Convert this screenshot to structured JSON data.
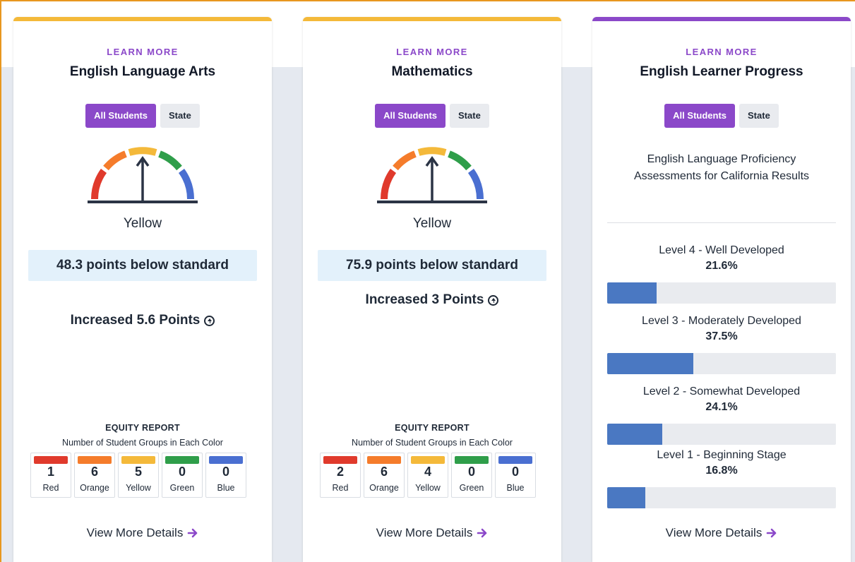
{
  "colors": {
    "accent_purple": "#8b48c9",
    "card_top_yellow": "#f4b93a",
    "status_box_bg": "#e3f1fb",
    "bar_fill_blue": "#4a78c2",
    "red": "#e03a2c",
    "orange": "#f57c2b",
    "yellow": "#f4b93a",
    "green": "#2f9e4a",
    "blue": "#4a6fd1"
  },
  "cards": [
    {
      "learn_more": "LEARN MORE",
      "title": "English Language Arts",
      "toggle": {
        "all_students": "All Students",
        "state": "State"
      },
      "gauge_icon": "performance-gauge-icon",
      "gauge_level": "Yellow",
      "status": "48.3 points below standard",
      "change": "Increased 5.6 Points",
      "equity": {
        "title": "EQUITY REPORT",
        "subtitle": "Number of Student Groups in Each Color",
        "cells": [
          {
            "count": "1",
            "label": "Red",
            "color": "#e03a2c"
          },
          {
            "count": "6",
            "label": "Orange",
            "color": "#f57c2b"
          },
          {
            "count": "5",
            "label": "Yellow",
            "color": "#f4b93a"
          },
          {
            "count": "0",
            "label": "Green",
            "color": "#2f9e4a"
          },
          {
            "count": "0",
            "label": "Blue",
            "color": "#4a6fd1"
          }
        ]
      },
      "details_link": "View More Details"
    },
    {
      "learn_more": "LEARN MORE",
      "title": "Mathematics",
      "toggle": {
        "all_students": "All Students",
        "state": "State"
      },
      "gauge_icon": "performance-gauge-icon",
      "gauge_level": "Yellow",
      "status": "75.9 points below standard",
      "change": "Increased 3 Points",
      "equity": {
        "title": "EQUITY REPORT",
        "subtitle": "Number of Student Groups in Each Color",
        "cells": [
          {
            "count": "2",
            "label": "Red",
            "color": "#e03a2c"
          },
          {
            "count": "6",
            "label": "Orange",
            "color": "#f57c2b"
          },
          {
            "count": "4",
            "label": "Yellow",
            "color": "#f4b93a"
          },
          {
            "count": "0",
            "label": "Green",
            "color": "#2f9e4a"
          },
          {
            "count": "0",
            "label": "Blue",
            "color": "#4a6fd1"
          }
        ]
      },
      "details_link": "View More Details"
    },
    {
      "learn_more": "LEARN MORE",
      "title": "English Learner Progress",
      "toggle": {
        "all_students": "All Students",
        "state": "State"
      },
      "description": "English Language Proficiency Assessments for California Results",
      "levels": [
        {
          "name": "Level 4 - Well Developed",
          "percent_label": "21.6%",
          "percent": 21.6
        },
        {
          "name": "Level 3 - Moderately Developed",
          "percent_label": "37.5%",
          "percent": 37.5
        },
        {
          "name": "Level 2 - Somewhat Developed",
          "percent_label": "24.1%",
          "percent": 24.1
        },
        {
          "name": "Level 1 - Beginning Stage",
          "percent_label": "16.8%",
          "percent": 16.8
        }
      ],
      "details_link": "View More Details"
    }
  ]
}
